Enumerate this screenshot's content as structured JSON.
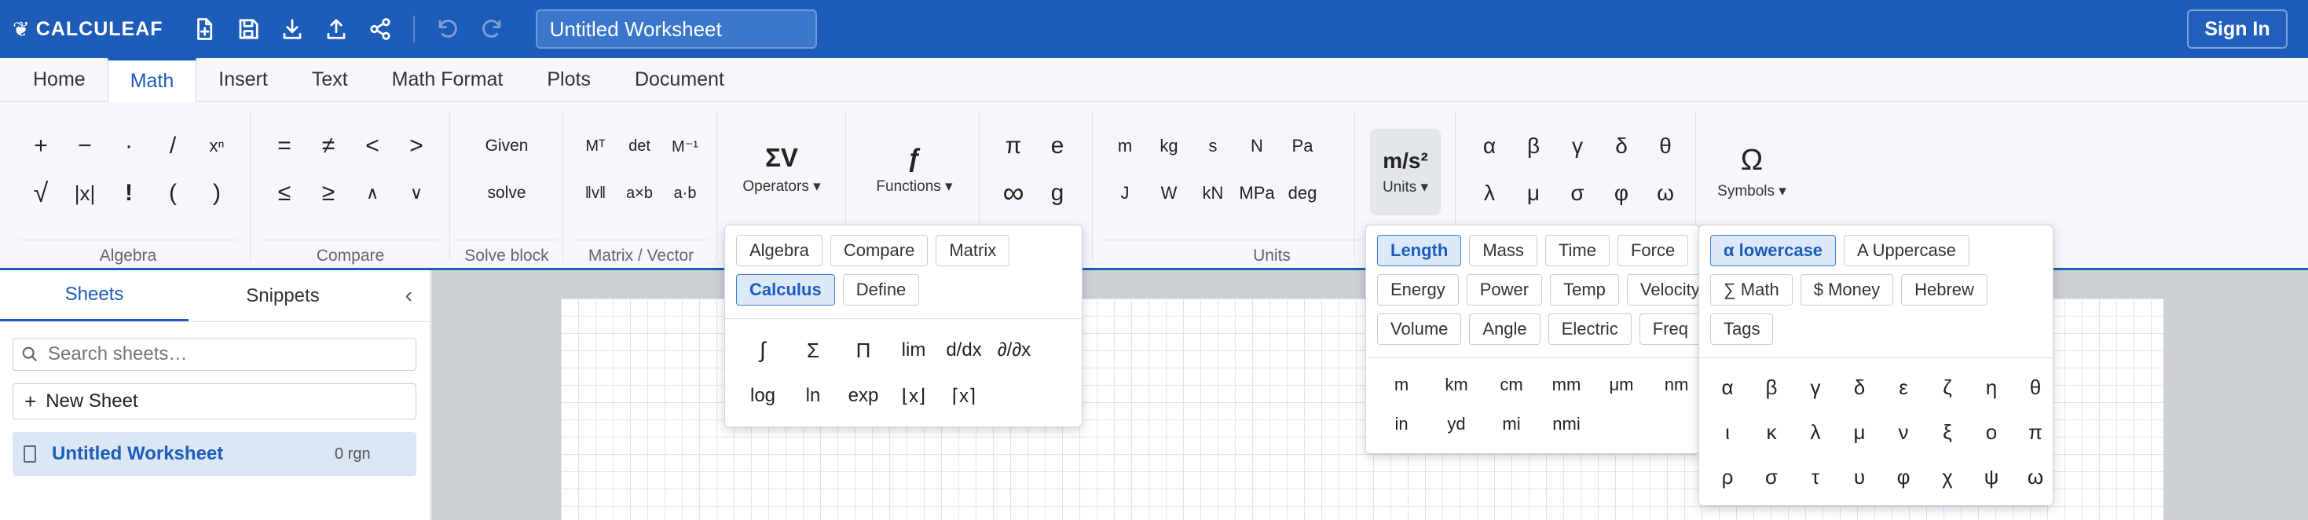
{
  "app": {
    "name": "CALCULEAF",
    "title_value": "Untitled Worksheet",
    "sign_in": "Sign In"
  },
  "toolbar_icons": [
    "new-file-icon",
    "save-icon",
    "download-icon",
    "upload-icon",
    "share-icon",
    "undo-icon",
    "redo-icon"
  ],
  "tabs": [
    "Home",
    "Math",
    "Insert",
    "Text",
    "Math Format",
    "Plots",
    "Document"
  ],
  "active_tab": "Math",
  "ribbon": {
    "algebra": {
      "label": "Algebra",
      "row1": [
        "+",
        "−",
        "·",
        "/",
        "xⁿ"
      ],
      "row2": [
        "√",
        "|x|",
        "!",
        "(",
        ")"
      ]
    },
    "compare": {
      "label": "Compare",
      "row1": [
        "=",
        "≠",
        "<",
        ">"
      ],
      "row2": [
        "≤",
        "≥",
        "∧",
        "∨"
      ]
    },
    "solve": {
      "label": "Solve block",
      "items": [
        "Given",
        "solve"
      ]
    },
    "matrix": {
      "label": "Matrix / Vector",
      "row1": [
        "Mᵀ",
        "det",
        "M⁻¹"
      ],
      "row2": [
        "‖v‖",
        "a×b",
        "a·b"
      ]
    },
    "operators": {
      "symbol": "ΣV",
      "label": "Operators ▾"
    },
    "functions": {
      "symbol": "ƒ",
      "label": "Functions ▾"
    },
    "constants": {
      "row1": [
        "π",
        "e"
      ],
      "row2": [
        "∞",
        "g"
      ]
    },
    "units": {
      "label": "Units",
      "row1": [
        "m",
        "kg",
        "s",
        "N",
        "Pa"
      ],
      "row2": [
        "J",
        "W",
        "kN",
        "MPa",
        "deg"
      ],
      "big_symbol": "m/s²",
      "big_label": "Units ▾"
    },
    "greek": {
      "row1": [
        "α",
        "β",
        "γ",
        "δ",
        "θ"
      ],
      "row2": [
        "λ",
        "μ",
        "σ",
        "φ",
        "ω"
      ]
    },
    "symbols": {
      "symbol": "Ω",
      "label": "Symbols ▾"
    }
  },
  "sidebar": {
    "tabs": [
      "Sheets",
      "Snippets"
    ],
    "collapse": "‹",
    "search_placeholder": "Search sheets…",
    "new_sheet": "New Sheet",
    "sheets": [
      {
        "name": "Untitled Worksheet",
        "meta": "0 rgn"
      }
    ]
  },
  "operators_popup": {
    "categories": [
      "Algebra",
      "Compare",
      "Matrix",
      "Calculus",
      "Define"
    ],
    "active": "Calculus",
    "items": [
      "∫",
      "Σ",
      "Π",
      "lim",
      "d/dx",
      "∂/∂x",
      "log",
      "ln",
      "exp",
      "⌊x⌋",
      "⌈x⌉"
    ]
  },
  "units_popup": {
    "categories": [
      "Length",
      "Mass",
      "Time",
      "Force",
      "Energy",
      "Power",
      "Temp",
      "Velocity",
      "Volume",
      "Angle",
      "Electric",
      "Freq"
    ],
    "active": "Length",
    "items": [
      "m",
      "km",
      "cm",
      "mm",
      "μm",
      "nm",
      "in",
      "yd",
      "mi",
      "nmi"
    ]
  },
  "symbols_popup": {
    "categories": [
      "α lowercase",
      "A Uppercase",
      "∑ Math",
      "$ Money",
      "Hebrew",
      "Tags"
    ],
    "active": "α lowercase",
    "items": [
      "α",
      "β",
      "γ",
      "δ",
      "ε",
      "ζ",
      "η",
      "θ",
      "ι",
      "κ",
      "λ",
      "μ",
      "ν",
      "ξ",
      "ο",
      "π",
      "ρ",
      "σ",
      "τ",
      "υ",
      "φ",
      "χ",
      "ψ",
      "ω"
    ]
  }
}
